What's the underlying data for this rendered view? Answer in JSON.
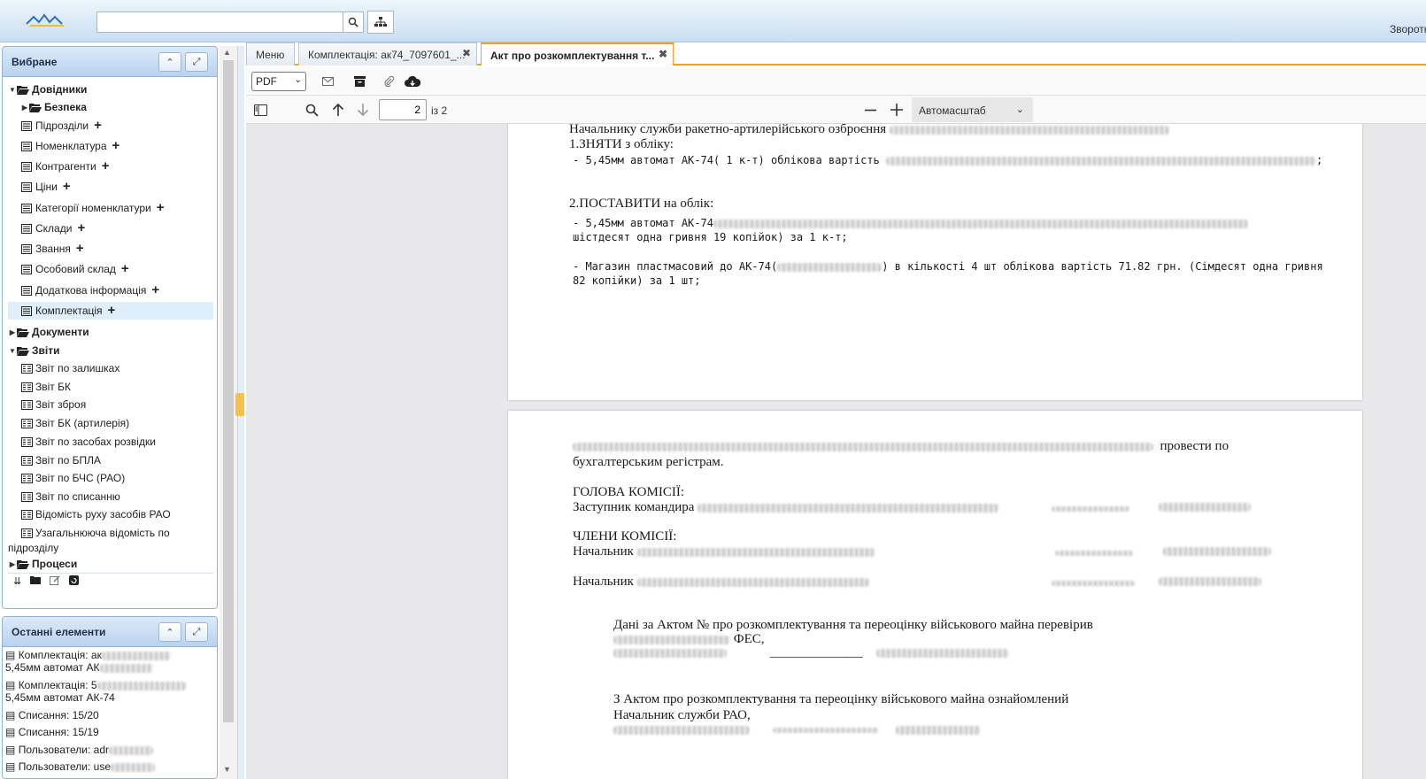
{
  "topbar": {
    "search_placeholder": "",
    "feedback_label": "Зворотн"
  },
  "favorites": {
    "title": "Вибране",
    "items": [
      {
        "label": "Довідники",
        "bold": true,
        "expanded": true
      },
      {
        "label": "Безпека",
        "bold": true
      },
      {
        "label": "Підрозділи"
      },
      {
        "label": "Номенклатура"
      },
      {
        "label": "Контрагенти"
      },
      {
        "label": "Ціни"
      },
      {
        "label": "Категорії номенклатури"
      },
      {
        "label": "Склади"
      },
      {
        "label": "Звання"
      },
      {
        "label": "Особовий склад"
      },
      {
        "label": "Додаткова інформація"
      },
      {
        "label": "Комплектація",
        "selected": true
      },
      {
        "label": "Документи",
        "bold": true
      },
      {
        "label": "Звіти",
        "bold": true,
        "expanded": true
      },
      {
        "label": "Звіт по залишках"
      },
      {
        "label": "Звіт БК"
      },
      {
        "label": "Звіт зброя"
      },
      {
        "label": "Звіт БК (артилерія)"
      },
      {
        "label": "Звіт по засобах розвідки"
      },
      {
        "label": "Звіт по БПЛА"
      },
      {
        "label": "Звіт по БЧС (РАО)"
      },
      {
        "label": "Звіт по списанню"
      },
      {
        "label": "Відомість руху засобів РАО"
      },
      {
        "label": "Узагальнююча відомість по"
      },
      {
        "label": "підрозділу"
      },
      {
        "label": "Процеси",
        "bold": true
      }
    ]
  },
  "recent": {
    "title": "Останні елементи",
    "items": [
      {
        "line1": "Комплектація: ак",
        "line2": "5,45мм автомат АК"
      },
      {
        "line1": "Комплектація: 5",
        "line2": "5,45мм автомат АК-74"
      },
      {
        "line1": "Списання: 15/20"
      },
      {
        "line1": "Списання: 15/19"
      },
      {
        "line1": "Пользователи: adr"
      },
      {
        "line1": "Пользователи: use"
      }
    ]
  },
  "tabs": [
    {
      "label": "Меню"
    },
    {
      "label": "Комплектація: ак74_7097601_..."
    },
    {
      "label": "Акт про розкомплектування т...",
      "active": true
    }
  ],
  "doc_toolbar": {
    "format": "PDF"
  },
  "pdf_toolbar": {
    "page_number": "2",
    "page_of": "із 2",
    "zoom": "Автомасштаб"
  },
  "document": {
    "page1": {
      "line1": "Начальнику служби ракетно-артилерійського озброєння",
      "line2": "1.ЗНЯТИ з обліку:",
      "line3": "- 5,45мм автомат АК-74( 1 к-т) облікова вартість",
      "line4": "2.ПОСТАВИТИ на облік:",
      "line5": "- 5,45мм автомат АК-74",
      "line6": "шістдесят одна гривня 19 копійок) за 1 к-т;",
      "line7a": "- Магазин пластмасовий до АК-74(",
      "line7b": ") в кількості 4 шт облікова вартість  71.82 грн. (Сімдесят одна гривня",
      "line8": "82 копійки) за 1 шт;"
    },
    "page2": {
      "l1_tail": "провести по",
      "l2": "бухгалтерським регістрам.",
      "l3": "ГОЛОВА КОМІСІЇ:",
      "l4": "Заступник командира",
      "l5": "ЧЛЕНИ КОМІСІЇ:",
      "l6": "Начальник",
      "l7": "Начальник",
      "l8": "Дані за Актом №  про розкомплектування та переоцінку військового майна перевірив",
      "l9": "ФЕС,",
      "l10": "______________",
      "l11": "З Актом  про розкомплектування та переоцінку військового майна ознайомлений",
      "l12": "Начальник служби РАО,"
    }
  }
}
